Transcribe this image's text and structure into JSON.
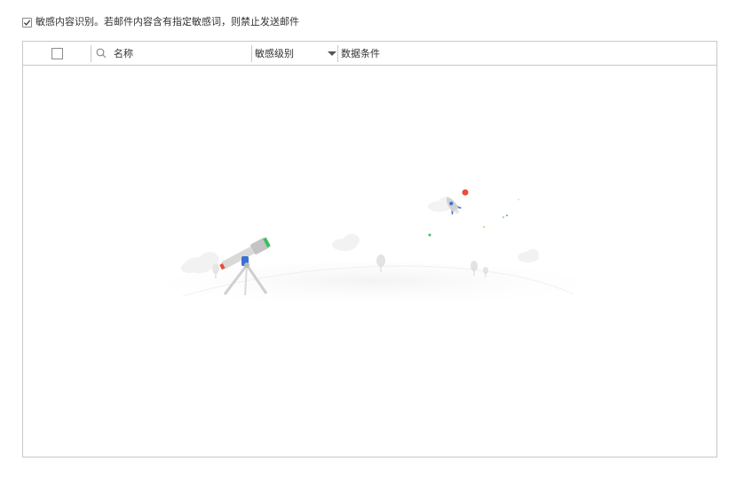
{
  "option": {
    "checked": true,
    "label": "敏感内容识别。若邮件内容含有指定敏感词，则禁止发送邮件"
  },
  "table": {
    "columns": {
      "name": "名称",
      "level": "敏感级别",
      "condition": "数据条件"
    }
  },
  "icons": {
    "check": "check-icon",
    "search": "search-icon",
    "dropdown": "caret-down-icon",
    "empty": "telescope-rocket-empty-illustration"
  },
  "colors": {
    "border": "#c8c8c8",
    "rocket_dot": "#e94e3c",
    "telescope_green": "#3fbf5f"
  }
}
